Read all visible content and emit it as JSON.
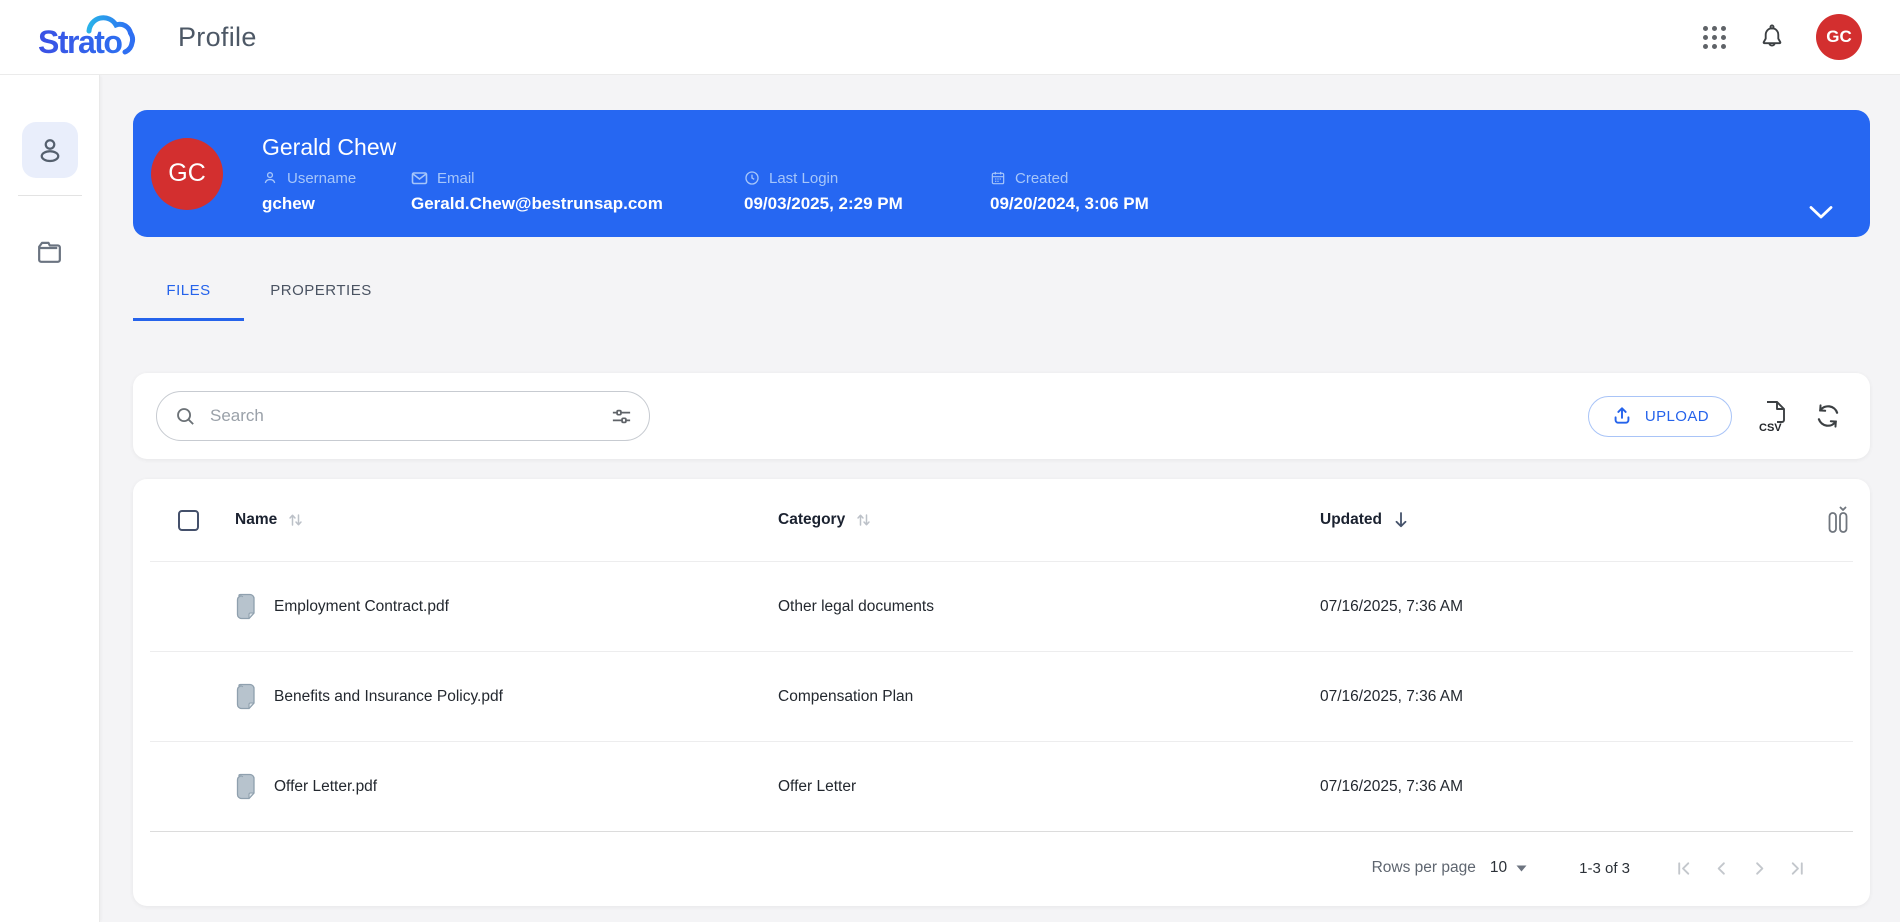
{
  "header": {
    "logo_text": "Strato",
    "page_title": "Profile",
    "avatar_initials": "GC"
  },
  "sidebar": {
    "items": [
      {
        "id": "profile",
        "icon": "person-icon",
        "active": true
      },
      {
        "id": "files",
        "icon": "folder-icon",
        "active": false
      }
    ]
  },
  "profile_banner": {
    "avatar_initials": "GC",
    "name": "Gerald Chew",
    "fields": [
      {
        "icon": "person-icon",
        "label": "Username",
        "value": "gchew"
      },
      {
        "icon": "envelope-icon",
        "label": "Email",
        "value": "Gerald.Chew@bestrunsap.com"
      },
      {
        "icon": "clock-icon",
        "label": "Last Login",
        "value": "09/03/2025, 2:29 PM"
      },
      {
        "icon": "calendar-icon",
        "label": "Created",
        "value": "09/20/2024, 3:06 PM"
      }
    ]
  },
  "tabs": [
    {
      "label": "FILES",
      "active": true
    },
    {
      "label": "PROPERTIES",
      "active": false
    }
  ],
  "toolbar": {
    "search_placeholder": "Search",
    "upload_label": "UPLOAD",
    "csv_icon_label": "CSV"
  },
  "files_table": {
    "columns": [
      {
        "label": "Name",
        "sort": "none"
      },
      {
        "label": "Category",
        "sort": "none"
      },
      {
        "label": "Updated",
        "sort": "desc"
      }
    ],
    "rows": [
      {
        "name": "Employment Contract.pdf",
        "category": "Other legal documents",
        "updated": "07/16/2025, 7:36 AM"
      },
      {
        "name": "Benefits and Insurance Policy.pdf",
        "category": "Compensation Plan",
        "updated": "07/16/2025, 7:36 AM"
      },
      {
        "name": "Offer Letter.pdf",
        "category": "Offer Letter",
        "updated": "07/16/2025, 7:36 AM"
      }
    ],
    "pagination": {
      "rows_per_page_label": "Rows per page",
      "rows_per_page_value": "10",
      "range_label": "1-3 of 3"
    }
  },
  "colors": {
    "banner_blue": "#2667f2",
    "avatar_red": "#d32f2f",
    "accent_blue": "#2563eb",
    "label_light_blue": "#a6c6fa",
    "page_background": "#f4f4f6"
  }
}
